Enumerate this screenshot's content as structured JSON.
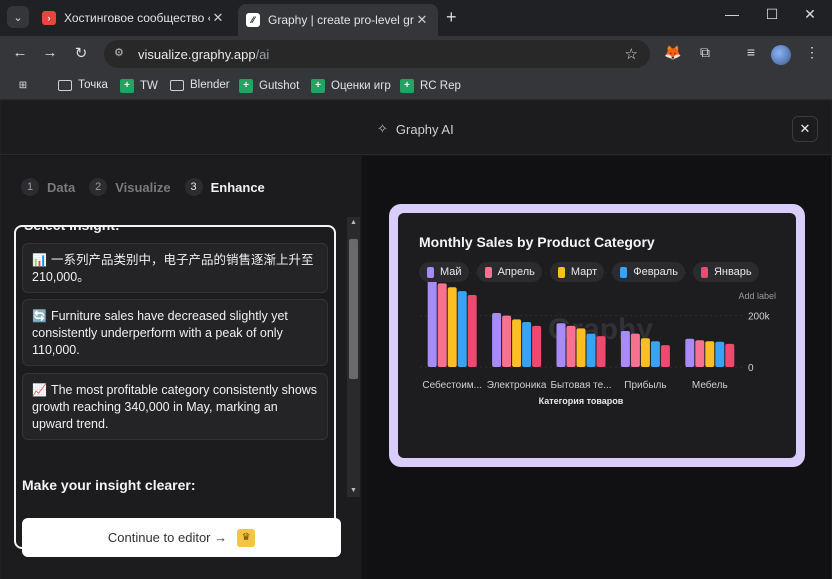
{
  "browser": {
    "tabs": [
      {
        "title": "Хостинговое сообщество «Tim",
        "active": false
      },
      {
        "title": "Graphy | create pro-level graph",
        "active": true
      }
    ],
    "url_host": "visualize.graphy.app",
    "url_path": "/ai",
    "bookmarks": [
      {
        "label": "Точка",
        "icon": "folder-icon"
      },
      {
        "label": "TW",
        "icon": "sheets-icon"
      },
      {
        "label": "Blender",
        "icon": "folder-icon"
      },
      {
        "label": "Gutshot",
        "icon": "sheets-icon"
      },
      {
        "label": "Оценки игр",
        "icon": "sheets-icon"
      },
      {
        "label": "RC Rep",
        "icon": "sheets-icon"
      }
    ]
  },
  "modal": {
    "title": "Graphy AI",
    "steps": [
      {
        "num": "1",
        "label": "Data"
      },
      {
        "num": "2",
        "label": "Visualize"
      },
      {
        "num": "3",
        "label": "Enhance"
      }
    ],
    "select_heading": "Select insight:",
    "insights": [
      {
        "emoji": "📊",
        "text": "一系列产品类别中，电子产品的销售逐渐上升至210,000。"
      },
      {
        "emoji": "🔄",
        "text": "Furniture sales have decreased slightly yet consistently underperform with a peak of only 110,000."
      },
      {
        "emoji": "📈",
        "text": "The most profitable category consistently shows growth reaching 340,000 in May, marking an upward trend."
      }
    ],
    "clearer_heading": "Make your insight clearer:",
    "continue_label": "Continue to editor →"
  },
  "chart_data": {
    "type": "bar",
    "title": "Monthly Sales by Product Category",
    "xlabel": "Категория товаров",
    "ylabel": "",
    "add_label": "Add label",
    "watermark": "Graphy",
    "categories": [
      "Себестоим...",
      "Электроника",
      "Бытовая те...",
      "Прибыль",
      "Мебель"
    ],
    "y_ticks": [
      "200k",
      "0"
    ],
    "ylim": [
      0,
      350000
    ],
    "series": [
      {
        "name": "Май",
        "color": "#a78bfa",
        "values": [
          340000,
          210000,
          170000,
          140000,
          110000
        ]
      },
      {
        "name": "Апрель",
        "color": "#f87190",
        "values": [
          325000,
          200000,
          160000,
          130000,
          104000
        ]
      },
      {
        "name": "Март",
        "color": "#fbbf24",
        "values": [
          310000,
          185000,
          150000,
          112000,
          100000
        ]
      },
      {
        "name": "Февраль",
        "color": "#38a3f5",
        "values": [
          295000,
          175000,
          130000,
          100000,
          98000
        ]
      },
      {
        "name": "Январь",
        "color": "#f0486f",
        "values": [
          280000,
          160000,
          120000,
          85000,
          90000
        ]
      }
    ]
  }
}
